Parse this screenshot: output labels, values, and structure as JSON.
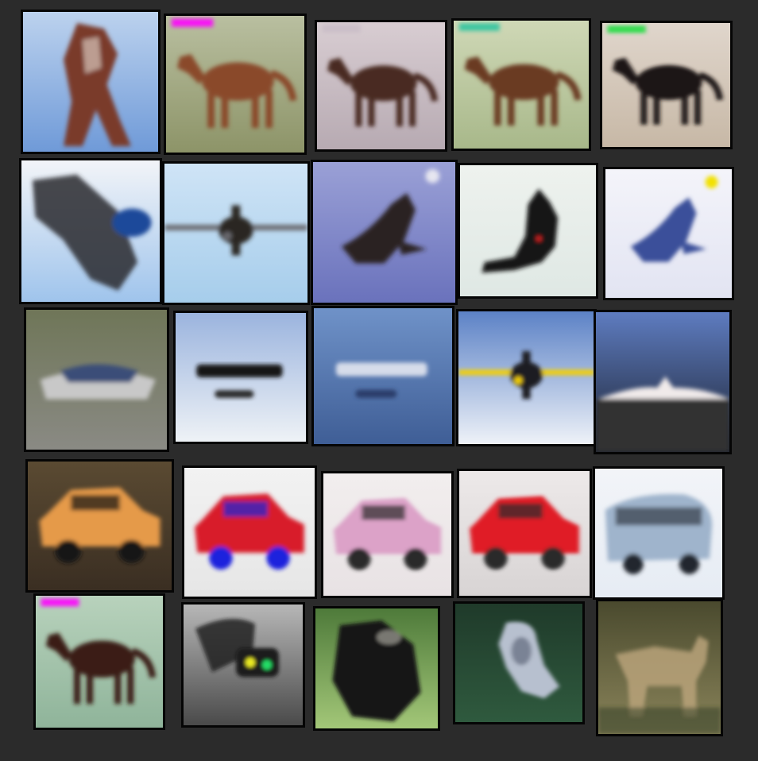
{
  "title": "",
  "tiles": [
    {
      "subject": "horse",
      "bg": [
        "#bcd2ee",
        "#6f9ad8"
      ],
      "main": "#7a3b2b",
      "accent": "#e8e0d6",
      "shape": "horse-rear"
    },
    {
      "subject": "horse",
      "bg": [
        "#b9bfa0",
        "#8d9468"
      ],
      "main": "#8a4a2a",
      "accent": "#ff00ff",
      "shape": "horse"
    },
    {
      "subject": "horse",
      "bg": [
        "#d8cdd2",
        "#b7aab2"
      ],
      "main": "#4a2a22",
      "accent": "#c9bcc6",
      "shape": "horse"
    },
    {
      "subject": "horse",
      "bg": [
        "#cfd8b6",
        "#a8b88a"
      ],
      "main": "#6a3a22",
      "accent": "#2ec4a0",
      "shape": "horse"
    },
    {
      "subject": "horse",
      "bg": [
        "#e0d6cc",
        "#c7b8a6"
      ],
      "main": "#1b1512",
      "accent": "#22dd44",
      "shape": "horse"
    },
    {
      "subject": "airplane",
      "bg": [
        "#f2f4f8",
        "#9fc4ec"
      ],
      "main": "#2c2c30",
      "accent": "#1c4a9a",
      "shape": "blob-diag"
    },
    {
      "subject": "airplane",
      "bg": [
        "#cfe4f6",
        "#a6cdeb"
      ],
      "main": "#2a2624",
      "accent": "#6a6a70",
      "shape": "plane"
    },
    {
      "subject": "airplane",
      "bg": [
        "#9aa0d6",
        "#6a72bc"
      ],
      "main": "#2b2420",
      "accent": "#e6e6f0",
      "shape": "bird"
    },
    {
      "subject": "airplane",
      "bg": [
        "#eef2ee",
        "#dfe8e4"
      ],
      "main": "#151515",
      "accent": "#dd2222",
      "shape": "cat"
    },
    {
      "subject": "airplane",
      "bg": [
        "#f4f4fa",
        "#e2e4f2"
      ],
      "main": "#3b4f9a",
      "accent": "#f2e100",
      "shape": "bird"
    },
    {
      "subject": "ship",
      "bg": [
        "#6f7658",
        "#8a8a84"
      ],
      "main": "#3a4e78",
      "accent": "#c8c8c8",
      "shape": "ship"
    },
    {
      "subject": "ship",
      "bg": [
        "#9bb4de",
        "#eef2f6"
      ],
      "main": "#121212",
      "accent": "#2a2a2a",
      "shape": "ship-flat"
    },
    {
      "subject": "ship",
      "bg": [
        "#6f92c8",
        "#3f5e96"
      ],
      "main": "#d6dcea",
      "accent": "#2c3e6a",
      "shape": "ship-flat"
    },
    {
      "subject": "ship",
      "bg": [
        "#5c82c6",
        "#eef2f8"
      ],
      "main": "#1a1c22",
      "accent": "#f4d000",
      "shape": "plane"
    },
    {
      "subject": "ship",
      "bg": [
        "#5e7cc0",
        "#1c2230"
      ],
      "main": "#f0eaea",
      "accent": "#333333",
      "shape": "ship-horizon"
    },
    {
      "subject": "automobile",
      "bg": [
        "#5a4a32",
        "#3a2e22"
      ],
      "main": "#e59a4a",
      "accent": "#121212",
      "shape": "car"
    },
    {
      "subject": "automobile",
      "bg": [
        "#f2f2f2",
        "#e6e6e6"
      ],
      "main": "#d81f2a",
      "accent": "#1a22dd",
      "shape": "car"
    },
    {
      "subject": "automobile",
      "bg": [
        "#f2eeee",
        "#e8e2e4"
      ],
      "main": "#dca2c8",
      "accent": "#2a2a2a",
      "shape": "car"
    },
    {
      "subject": "automobile",
      "bg": [
        "#ede9e9",
        "#d8d4d4"
      ],
      "main": "#e01c28",
      "accent": "#2a2a2a",
      "shape": "car"
    },
    {
      "subject": "automobile",
      "bg": [
        "#f2f4f8",
        "#e6ecf4"
      ],
      "main": "#9fb4cc",
      "accent": "#22262e",
      "shape": "bus"
    },
    {
      "subject": "horse",
      "bg": [
        "#b8d2bc",
        "#8fb49a"
      ],
      "main": "#3a1e16",
      "accent": "#ff00ff",
      "shape": "horse"
    },
    {
      "subject": "cat",
      "bg": [
        "#b7b7b7",
        "#4a4a4a"
      ],
      "main": "#1a1a1a",
      "accent": "#eaea20",
      "shape": "face"
    },
    {
      "subject": "dog",
      "bg": [
        "#4e7a3a",
        "#a3c778"
      ],
      "main": "#161514",
      "accent": "#dcdcd0",
      "shape": "blob"
    },
    {
      "subject": "bird",
      "bg": [
        "#1f3a2a",
        "#2f5a3e"
      ],
      "main": "#b7c0cf",
      "accent": "#525a6e",
      "shape": "bird-sit"
    },
    {
      "subject": "deer",
      "bg": [
        "#4a4a2e",
        "#8a845a"
      ],
      "main": "#b8a27a",
      "accent": "#2a3a22",
      "shape": "deer"
    }
  ]
}
